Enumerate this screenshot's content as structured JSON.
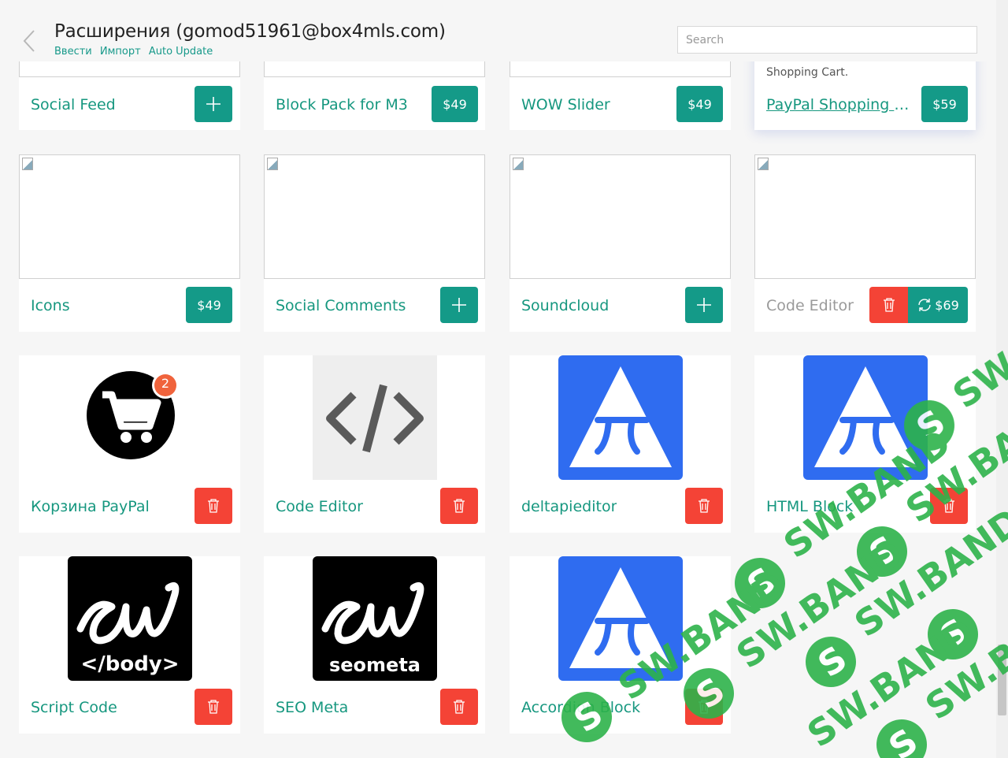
{
  "header": {
    "title": "Расширения (gomod51961@box4mls.com)",
    "links": [
      "Ввести",
      "Импорт",
      "Auto Update"
    ],
    "search_placeholder": "Search"
  },
  "cards": [
    {
      "name": "Social Feed",
      "action": "add"
    },
    {
      "name": "Block Pack for M3",
      "price": "$49"
    },
    {
      "name": "WOW Slider",
      "price": "$49"
    },
    {
      "name": "PayPal Shopping C...",
      "price": "$59",
      "description": "Shopping Cart."
    },
    {
      "name": "Icons",
      "price": "$49"
    },
    {
      "name": "Social Comments",
      "action": "add"
    },
    {
      "name": "Soundcloud",
      "action": "add"
    },
    {
      "name": "Code Editor",
      "price": "$69",
      "action": "delete-update"
    },
    {
      "name": "Корзина PayPal",
      "action": "delete",
      "badge": "2"
    },
    {
      "name": "Code Editor",
      "action": "delete"
    },
    {
      "name": "deltapieditor",
      "action": "delete"
    },
    {
      "name": "HTML Block",
      "action": "delete"
    },
    {
      "name": "Script Code",
      "action": "delete",
      "logo_text": "</body>"
    },
    {
      "name": "SEO Meta",
      "action": "delete",
      "logo_text": "seometa"
    },
    {
      "name": "Accordion Block",
      "action": "delete"
    }
  ],
  "watermark": "SW.BAND",
  "colors": {
    "accent": "#149a88",
    "delete": "#f44336",
    "brand_blue": "#2f6cf0",
    "badge": "#f0633c",
    "watermark": "#2db34a"
  }
}
